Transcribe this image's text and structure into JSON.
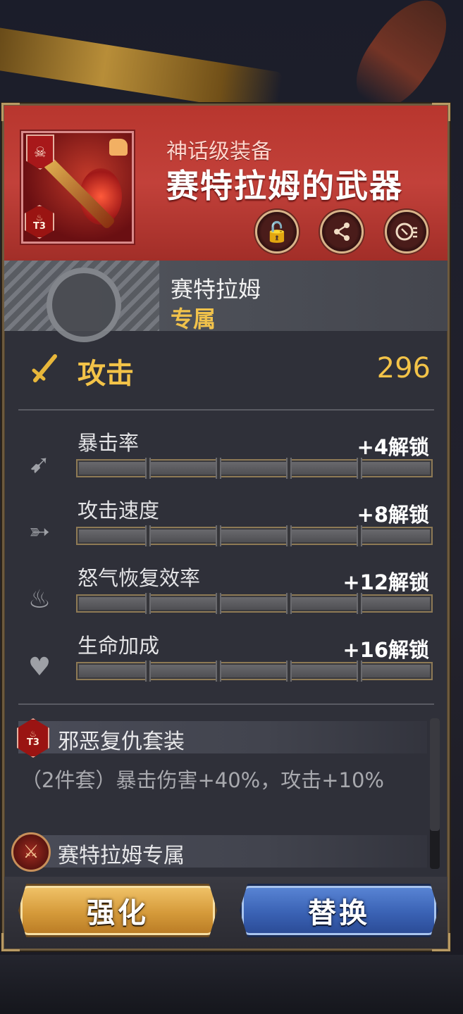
{
  "item": {
    "rarity": "神话级装备",
    "name": "赛特拉姆的武器",
    "tier_badge": "T3",
    "hero_name": "赛特拉姆",
    "exclusive_label": "专属"
  },
  "main_stat": {
    "label": "攻击",
    "value": "296"
  },
  "sub_stats": [
    {
      "name": "暴击率",
      "unlock": "+4解锁",
      "icon": "crit-arrow-icon"
    },
    {
      "name": "攻击速度",
      "unlock": "+8解锁",
      "icon": "speed-icon"
    },
    {
      "name": "怒气恢复效率",
      "unlock": "+12解锁",
      "icon": "rage-flame-icon"
    },
    {
      "name": "生命加成",
      "unlock": "+16解锁",
      "icon": "heart-percent-icon"
    }
  ],
  "set": {
    "badge_tier": "T3",
    "name": "邪恶复仇套装",
    "description": "（2件套）暴击伤害+40%，攻击+10%"
  },
  "exclusive_set": {
    "name": "赛特拉姆专属"
  },
  "buttons": {
    "enhance": "强化",
    "replace": "替换"
  },
  "colors": {
    "header_red": "#c2413a",
    "gold_text": "#f3c348",
    "panel_bg": "#2f3039",
    "enhance_gold": "#d59a3a",
    "replace_blue": "#3a62b4"
  }
}
